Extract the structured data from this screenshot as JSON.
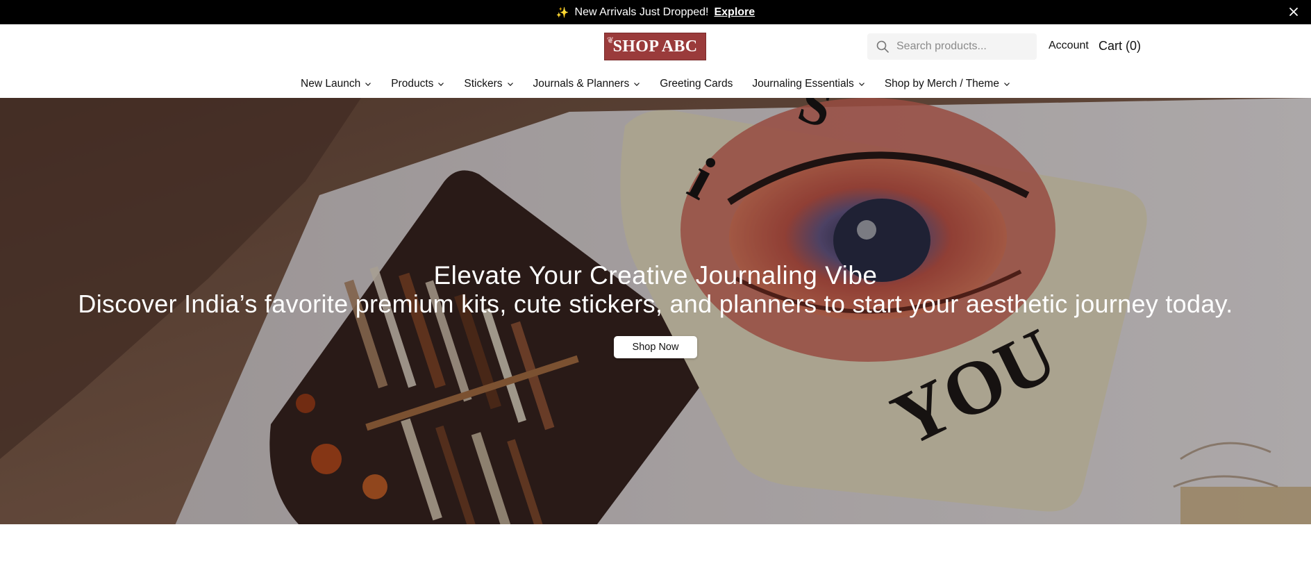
{
  "announcement": {
    "text": "New Arrivals Just Dropped!",
    "link_label": "Explore",
    "sparkle_icon": "sparkle-icon",
    "close_icon": "close-icon"
  },
  "header": {
    "logo_text": "SHOP ABC",
    "search_placeholder": "Search products...",
    "account_label": "Account",
    "cart_label": "Cart (0)"
  },
  "nav": {
    "items": [
      {
        "label": "New Launch",
        "has_dropdown": true
      },
      {
        "label": "Products",
        "has_dropdown": true
      },
      {
        "label": "Stickers",
        "has_dropdown": true
      },
      {
        "label": "Journals & Planners",
        "has_dropdown": true
      },
      {
        "label": "Greeting Cards",
        "has_dropdown": false
      },
      {
        "label": "Journaling Essentials",
        "has_dropdown": true
      },
      {
        "label": "Shop by Merch / Theme",
        "has_dropdown": true
      }
    ]
  },
  "hero": {
    "title": "Elevate Your Creative Journaling Vibe",
    "subtitle": "Discover India’s favorite premium kits, cute stickers, and planners to start your aesthetic journey today.",
    "cta_label": "Shop Now"
  },
  "colors": {
    "announcement_bg": "#000000",
    "logo_bg": "#9a3b3b",
    "search_bg": "#f4f4f4"
  }
}
